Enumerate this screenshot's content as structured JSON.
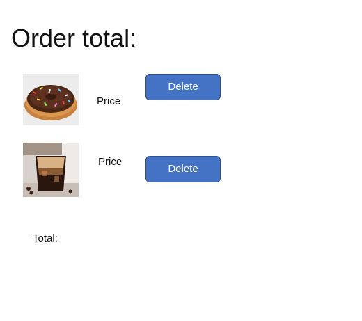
{
  "page": {
    "title": "Order total:"
  },
  "items": [
    {
      "image_icon": "chocolate-donut-image",
      "price_label": "Price",
      "delete_label": "Delete"
    },
    {
      "image_icon": "iced-coffee-image",
      "price_label": "Price",
      "delete_label": "Delete"
    }
  ],
  "summary": {
    "total_label": "Total:"
  },
  "colors": {
    "button_bg": "#4472c4",
    "button_border": "#2f4f86",
    "button_text": "#ffffff"
  }
}
